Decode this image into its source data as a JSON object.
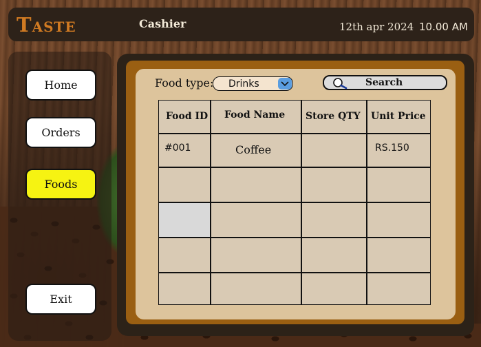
{
  "header": {
    "logo": "Taste",
    "role": "Cashier",
    "date": "12th apr 2024",
    "time": "10.00 AM"
  },
  "sidebar": {
    "items": [
      {
        "label": "Home",
        "active": false
      },
      {
        "label": "Orders",
        "active": false
      },
      {
        "label": "Foods",
        "active": true
      },
      {
        "label": "Exit",
        "active": false
      }
    ]
  },
  "filters": {
    "food_type_label": "Food type:",
    "food_type_value": "Drinks",
    "search_label": "Search"
  },
  "table": {
    "columns": [
      "Food ID",
      "Food Name",
      "Store QTY",
      "Unit Price"
    ],
    "rows": [
      [
        "#001",
        "Coffee",
        "",
        "RS.150"
      ],
      [
        "",
        "",
        "",
        ""
      ],
      [
        "",
        "",
        "",
        ""
      ],
      [
        "",
        "",
        "",
        ""
      ],
      [
        "",
        "",
        "",
        ""
      ]
    ]
  },
  "colors": {
    "active_nav": "#f6f312",
    "logo": "#d07a22",
    "panel_frame": "#9a5f12"
  }
}
